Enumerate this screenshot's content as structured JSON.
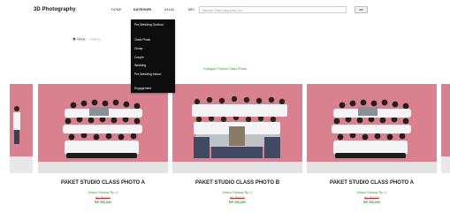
{
  "header": {
    "brand": "3D Photography",
    "nav": [
      "HOME",
      "KATEGORI",
      "AKUN"
    ],
    "user_label": "MEI",
    "search_placeholder": "Masukan Paket yang Anda Cari...",
    "search_button": "cari"
  },
  "breadcrumb": {
    "home": "Home",
    "current": "Gallery"
  },
  "dropdown": {
    "items": [
      "Pre-Wedding Outdoor",
      "Class Photo",
      "Group",
      "Couple",
      "Wedding",
      "Pre-Wedding Indoor",
      "Engagement"
    ]
  },
  "category_title": "Kategori Produk Class Photo",
  "products": [
    {
      "title": "PAKET STUDIO CLASS PHOTO A",
      "discount": "Diskon Sebesar Rp. 0",
      "old_price": "Rp 250,000",
      "price": "RP 250,000"
    },
    {
      "title": "PAKET STUDIO CLASS PHOTO B",
      "discount": "Diskon Sebesar Rp. 0",
      "old_price": "Rp 250,000",
      "price": "RP 250,000"
    },
    {
      "title": "PAKET STUDIO CLASS PHOTO A",
      "discount": "Diskon Sebesar Rp. 0",
      "old_price": "Rp 250,000",
      "price": "RP 250,000"
    }
  ],
  "colors": {
    "accent_green": "#2e9a2e",
    "dropdown_bg": "#0d0d0d",
    "photo_bg": "#d9818e"
  }
}
